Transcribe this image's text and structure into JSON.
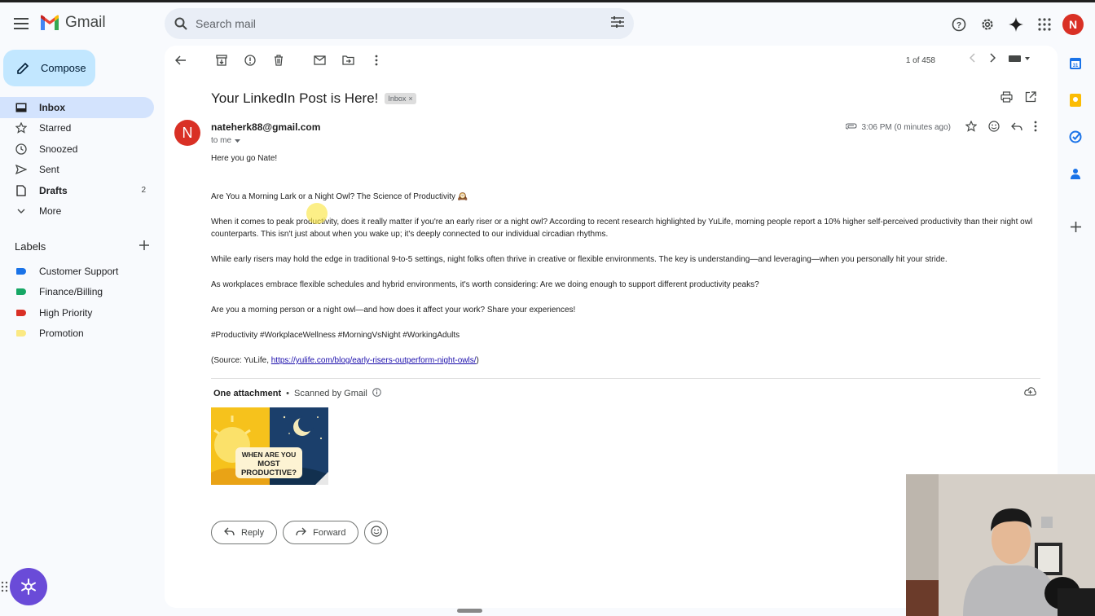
{
  "app": {
    "name": "Gmail"
  },
  "search": {
    "placeholder": "Search mail"
  },
  "header": {
    "avatar_letter": "N"
  },
  "compose": {
    "label": "Compose"
  },
  "nav": [
    {
      "label": "Inbox",
      "icon": "inbox-icon",
      "active": true,
      "count": ""
    },
    {
      "label": "Starred",
      "icon": "star-icon",
      "count": ""
    },
    {
      "label": "Snoozed",
      "icon": "clock-icon",
      "count": ""
    },
    {
      "label": "Sent",
      "icon": "send-icon",
      "count": ""
    },
    {
      "label": "Drafts",
      "icon": "draft-icon",
      "count": "2"
    },
    {
      "label": "More",
      "icon": "chevron-down-icon",
      "count": ""
    }
  ],
  "labels": {
    "title": "Labels",
    "items": [
      {
        "name": "Customer Support",
        "color": "#1a73e8"
      },
      {
        "name": "Finance/Billing",
        "color": "#16a765"
      },
      {
        "name": "High Priority",
        "color": "#d93025"
      },
      {
        "name": "Promotion",
        "color": "#fbe983"
      }
    ]
  },
  "pager": {
    "text": "1 of 458"
  },
  "email": {
    "subject": "Your LinkedIn Post is Here!",
    "chip": "Inbox",
    "chip_close": "×",
    "sender": "nateherk88@gmail.com",
    "sender_initial": "N",
    "to": "to me",
    "time": "3:06 PM (0 minutes ago)",
    "greeting": "Here you go Nate!",
    "headline": "Are You a Morning Lark or a Night Owl? The Science of Productivity",
    "headline_emoji": "🕰️",
    "para1": "When it comes to peak productivity, does it really matter if you're an early riser or a night owl? According to recent research highlighted by YuLife, morning people report a 10% higher self-perceived productivity than their night owl counterparts. This isn't just about when you wake up; it's deeply connected to our individual circadian rhythms.",
    "para2": "While early risers may hold the edge in traditional 9-to-5 settings, night folks often thrive in creative or flexible environments. The key is understanding—and leveraging—when you personally hit your stride.",
    "para3": "As workplaces embrace flexible schedules and hybrid environments, it's worth considering: Are we doing enough to support different productivity peaks?",
    "para4": "Are you a morning person or a night owl—and how does it affect your work? Share your experiences!",
    "hashtags": "#Productivity #WorkplaceWellness #MorningVsNight #WorkingAdults",
    "source_prefix": "(Source: YuLife, ",
    "source_link": "https://yulife.com/blog/early-risers-outperform-night-owls/",
    "source_suffix": ")"
  },
  "attachment": {
    "title": "One attachment",
    "dot": "•",
    "scanned": "Scanned by Gmail",
    "thumb_text": [
      "WHEN ARE YOU",
      "MOST",
      "PRODUCTIVE?"
    ]
  },
  "actions": {
    "reply": "Reply",
    "forward": "Forward"
  }
}
